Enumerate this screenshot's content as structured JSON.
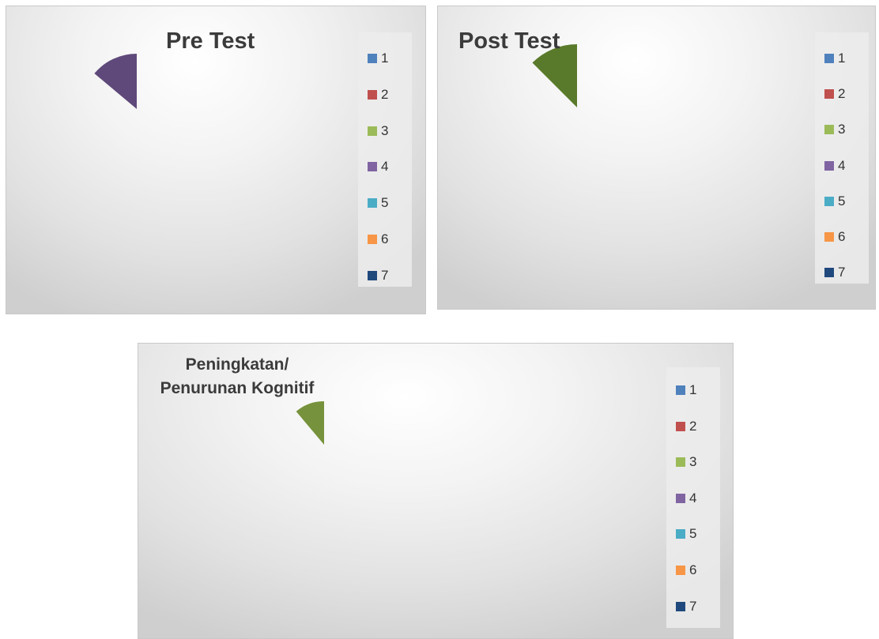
{
  "colors": [
    "#4f81bd",
    "#c0504d",
    "#9bbb59",
    "#8064a2",
    "#4bacc6",
    "#f79646",
    "#1f497d"
  ],
  "chart_data": [
    {
      "type": "pie",
      "title": "Pre Test",
      "categories": [
        "1",
        "2",
        "3",
        "4",
        "5",
        "6",
        "7"
      ],
      "visible_slices": [
        {
          "category": "4",
          "start_angle": 0,
          "end_angle": 50,
          "color": "#5f497a"
        }
      ],
      "legend": "right"
    },
    {
      "type": "pie",
      "title": "Post Test",
      "categories": [
        "1",
        "2",
        "3",
        "4",
        "5",
        "6",
        "7"
      ],
      "visible_slices": [
        {
          "category": "3",
          "start_angle": 0,
          "end_angle": 45,
          "color": "#5a7a2b"
        }
      ],
      "legend": "right"
    },
    {
      "type": "pie",
      "title": "Peningkatan/\nPenurunan Kognitif",
      "title_lines": [
        "Peningkatan/",
        "Penurunan Kognitif"
      ],
      "categories": [
        "1",
        "2",
        "3",
        "4",
        "5",
        "6",
        "7"
      ],
      "visible_slices": [
        {
          "category": "3",
          "start_angle": 0,
          "end_angle": 40,
          "color": "#76923c"
        }
      ],
      "legend": "right"
    }
  ]
}
